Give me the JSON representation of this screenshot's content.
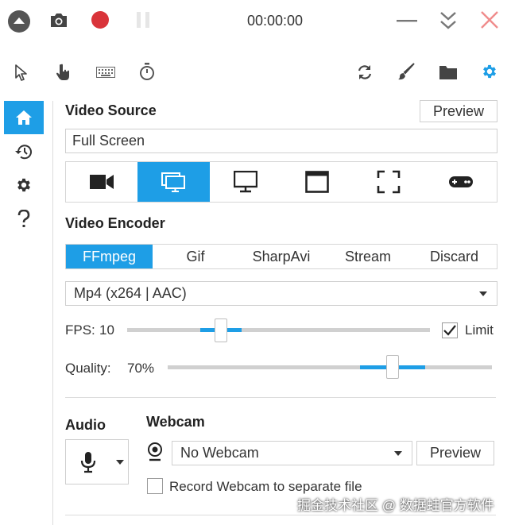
{
  "topbar": {
    "timer": "00:00:00"
  },
  "video_source": {
    "title": "Video Source",
    "preview_label": "Preview",
    "value": "Full Screen",
    "active_index": 1
  },
  "video_encoder": {
    "title": "Video Encoder",
    "tabs": [
      "FFmpeg",
      "Gif",
      "SharpAvi",
      "Stream",
      "Discard"
    ],
    "active_index": 0,
    "format": "Mp4 (x264 | AAC)"
  },
  "fps": {
    "label": "FPS:",
    "value": "10",
    "limit_label": "Limit",
    "limit_checked": true
  },
  "quality": {
    "label": "Quality:",
    "value": "70%"
  },
  "audio": {
    "title": "Audio"
  },
  "webcam": {
    "title": "Webcam",
    "value": "No Webcam",
    "preview_label": "Preview",
    "separate_label": "Record Webcam to separate file",
    "separate_checked": false
  },
  "watermark": "掘金技术社区 @ 数据蛙官方软件",
  "colors": {
    "accent": "#1e9ee6",
    "record": "#d9343a",
    "close": "#f08c8c"
  }
}
